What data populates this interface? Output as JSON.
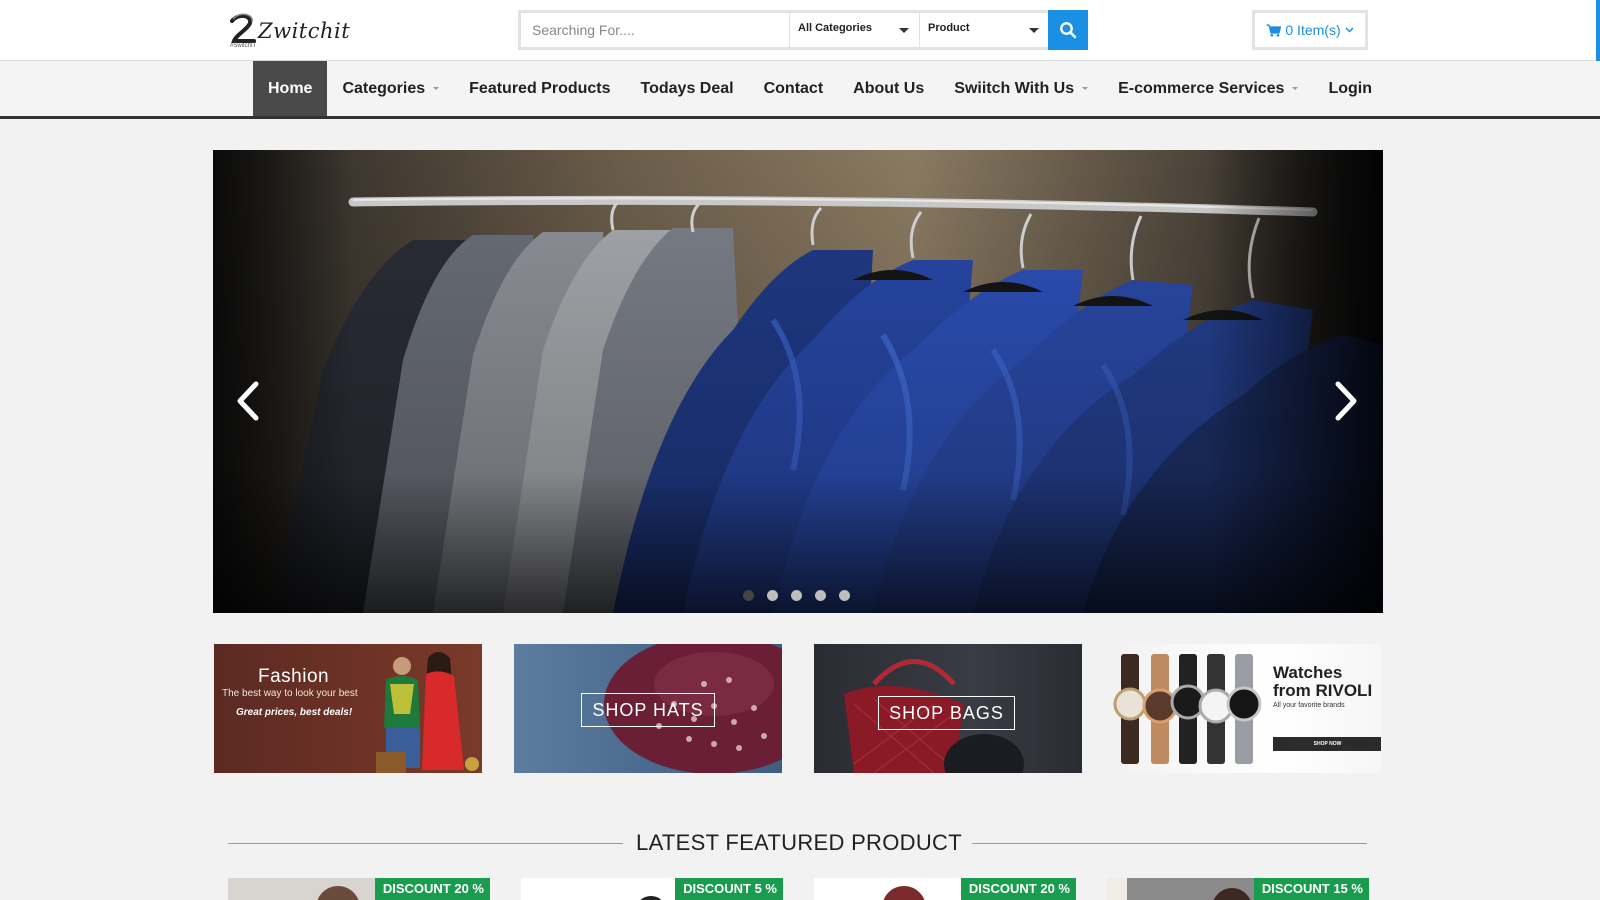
{
  "header": {
    "logo_text": "Zwitchit",
    "logo_tagline": "#SwitchIT",
    "search": {
      "placeholder": "Searching For....",
      "category_select": "All Categories",
      "type_select": "Product",
      "button_icon": "search-icon"
    },
    "cart": {
      "icon": "shopping-cart-icon",
      "label": "0 Item(s)"
    }
  },
  "nav": {
    "items": [
      {
        "label": "Home",
        "active": true,
        "dropdown": false
      },
      {
        "label": "Categories",
        "active": false,
        "dropdown": true
      },
      {
        "label": "Featured Products",
        "active": false,
        "dropdown": false
      },
      {
        "label": "Todays Deal",
        "active": false,
        "dropdown": false
      },
      {
        "label": "Contact",
        "active": false,
        "dropdown": false
      },
      {
        "label": "About Us",
        "active": false,
        "dropdown": false
      },
      {
        "label": "Swiitch With Us",
        "active": false,
        "dropdown": true
      },
      {
        "label": "E-commerce Services",
        "active": false,
        "dropdown": true
      },
      {
        "label": "Login",
        "active": false,
        "dropdown": false
      }
    ]
  },
  "carousel": {
    "slide_count": 5,
    "active_slide": 1,
    "prev_icon": "chevron-left-icon",
    "next_icon": "chevron-right-icon"
  },
  "promos": {
    "fashion": {
      "title": "Fashion",
      "subtitle": "The best way to look your best",
      "tagline": "Great prices, best deals!"
    },
    "hats": {
      "label": "SHOP HATS"
    },
    "bags": {
      "label": "SHOP BAGS"
    },
    "watches": {
      "title": "Watches from RIVOLI",
      "subtitle": "All your favorite brands",
      "button": "SHOP NOW"
    }
  },
  "latest": {
    "title": "LATEST FEATURED PRODUCT",
    "products": [
      {
        "badge": "DISCOUNT 20 %"
      },
      {
        "badge": "DISCOUNT 5 %"
      },
      {
        "badge": "DISCOUNT 20 %"
      },
      {
        "badge": "DISCOUNT 15 %"
      }
    ]
  },
  "colors": {
    "accent": "#1a8fe3",
    "nav_active": "#4a4a4a",
    "discount_badge": "#1a9c4e"
  }
}
